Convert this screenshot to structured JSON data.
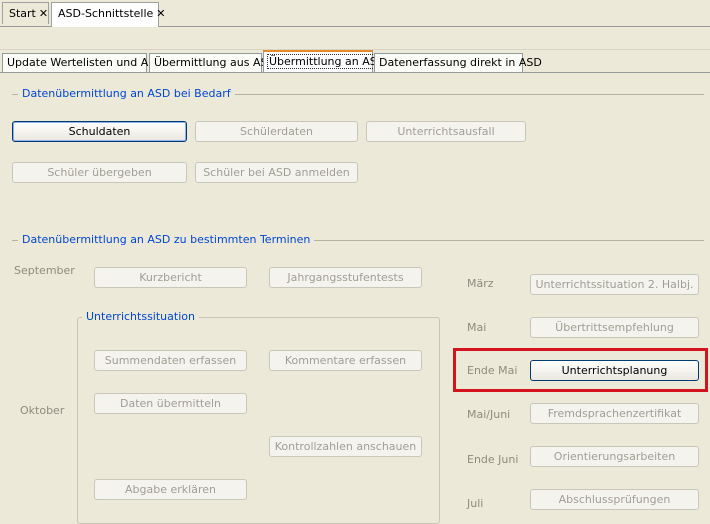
{
  "doc_tabs": [
    {
      "label": "Start"
    },
    {
      "label": "ASD-Schnittstelle"
    }
  ],
  "sub_tabs": [
    {
      "label": "Update Wertelisten und ASV"
    },
    {
      "label": "Übermittlung aus ASD"
    },
    {
      "label": "Übermittlung an ASD"
    },
    {
      "label": "Datenerfassung direkt in ASD"
    }
  ],
  "group_bedarf": {
    "title": "Datenübermittlung an ASD bei Bedarf",
    "buttons": [
      "Schuldaten",
      "Schülerdaten",
      "Unterrichtsausfall",
      "Schüler übergeben",
      "Schüler bei ASD anmelden"
    ]
  },
  "group_termine": {
    "title": "Datenübermittlung an ASD zu bestimmten Terminen",
    "september": "September",
    "oktober": "Oktober",
    "kurzbericht": "Kurzbericht",
    "jahrgang": "Jahrgangsstufentests",
    "unterrichtssituation_title": "Unterrichtssituation",
    "summendaten": "Summendaten erfassen",
    "kommentare": "Kommentare erfassen",
    "daten_uebermitteln": "Daten übermitteln",
    "kontrollzahlen": "Kontrollzahlen anschauen",
    "abgabe": "Abgabe erklären",
    "right": [
      {
        "month": "März",
        "button": "Unterrichtssituation 2. Halbj."
      },
      {
        "month": "Mai",
        "button": "Übertrittsempfehlung"
      },
      {
        "month": "Ende Mai",
        "button": "Unterrichtsplanung"
      },
      {
        "month": "Mai/Juni",
        "button": "Fremdsprachenzertifikat"
      },
      {
        "month": "Ende Juni",
        "button": "Orientierungsarbeiten"
      },
      {
        "month": "Juli",
        "button": "Abschlussprüfungen"
      }
    ]
  },
  "colors": {
    "accent": "#0046D5",
    "highlight": "#D3141C",
    "active_tab": "#E68B2C"
  }
}
